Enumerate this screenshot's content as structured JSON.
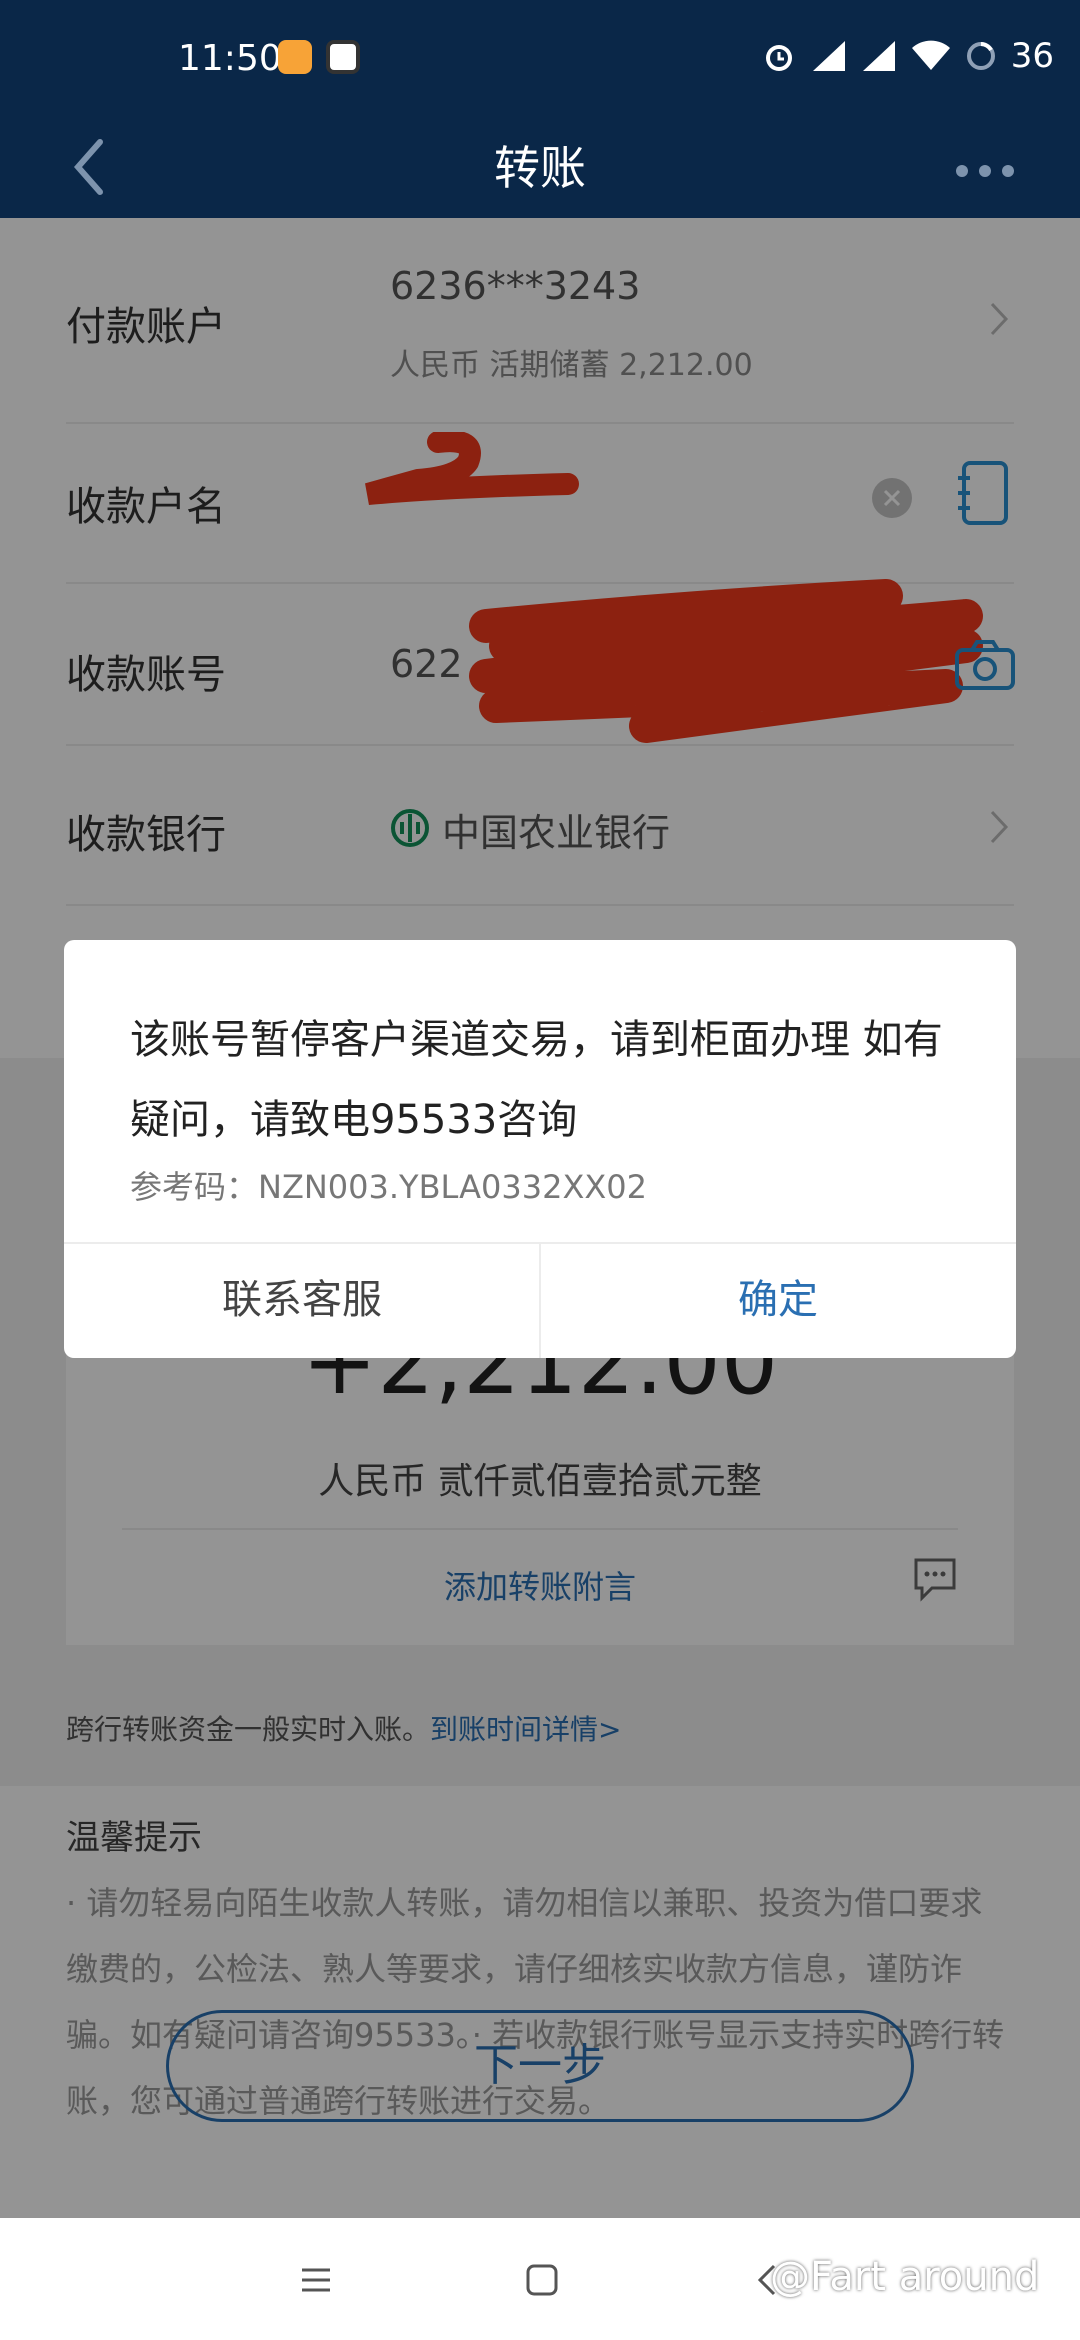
{
  "status_bar": {
    "time": "11:50",
    "battery": "36"
  },
  "header": {
    "title": "转账"
  },
  "form": {
    "payer": {
      "label": "付款账户",
      "account": "6236***3243",
      "detail": "人民币  活期储蓄  2,212.00"
    },
    "payee_name": {
      "label": "收款户名"
    },
    "payee_account": {
      "label": "收款账号",
      "partial": "622"
    },
    "payee_bank": {
      "label": "收款银行",
      "bank": "中国农业银行"
    }
  },
  "amount": {
    "value": "+2,212.00",
    "uppercase": "人民币  贰仟贰佰壹拾贰元整",
    "memo_link": "添加转账附言"
  },
  "note": {
    "text": "跨行转账资金一般实时入账。",
    "link": "到账时间详情>"
  },
  "tips": {
    "title": "温馨提示",
    "body": "· 请勿轻易向陌生收款人转账，请勿相信以兼职、投资为借口要求缴费的，公检法、熟人等要求，请仔细核实收款方信息，谨防诈骗。如有疑问请咨询95533。· 若收款银行账号显示支持实时跨行转账，您可通过普通跨行转账进行交易。"
  },
  "next_button": "下一步",
  "dialog": {
    "message": "该账号暂停客户渠道交易，请到柜面办理 如有疑问，请致电95533咨询",
    "ref": "参考码：NZN003.YBLA0332XX02",
    "left_button": "联系客服",
    "right_button": "确定"
  },
  "watermark": "@Fart around",
  "colors": {
    "header": "#0a2748",
    "accent": "#2a6fb2",
    "redaction": "#f23a1c"
  }
}
